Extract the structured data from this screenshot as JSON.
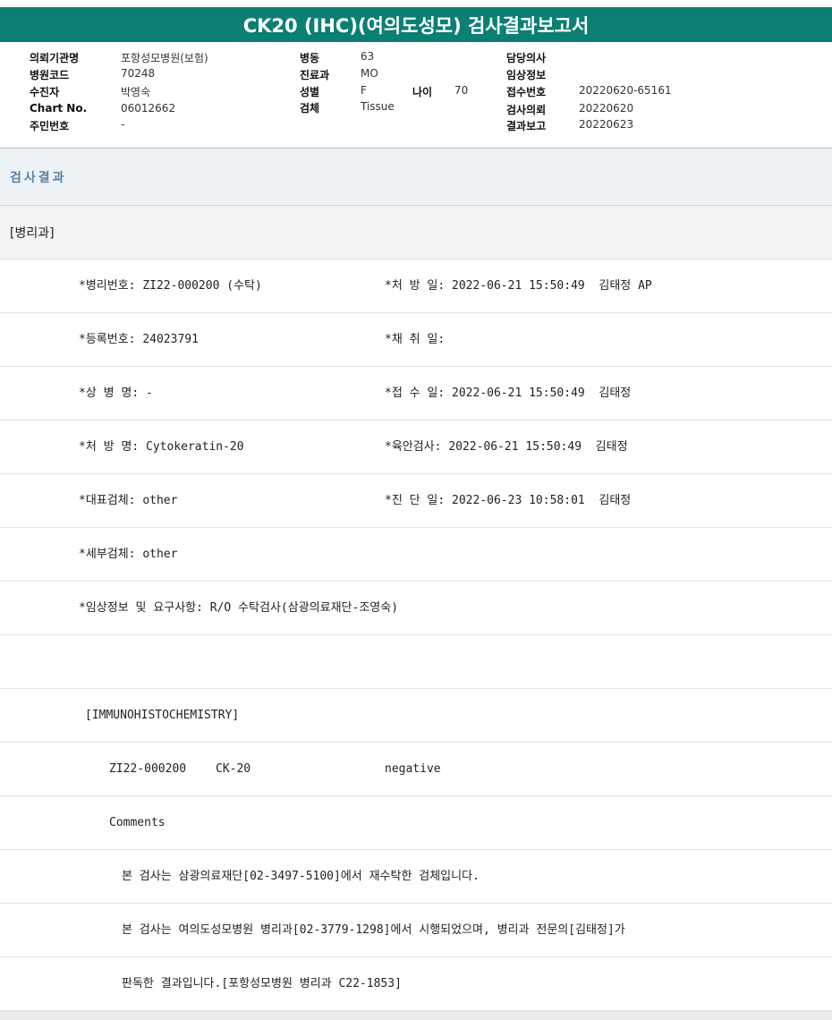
{
  "title": "CK20 (IHC)(여의도성모) 검사결과보고서",
  "header": {
    "institution_label": "의뢰기관명",
    "institution_value": "포항성모병원(보험)",
    "hospital_code_label": "병원코드",
    "hospital_code_value": "70248",
    "examinee_label": "수진자",
    "examinee_value": "박영숙",
    "chart_no_label": "Chart No.",
    "chart_no_value": "06012662",
    "resident_no_label": "주민번호",
    "resident_no_value": "-",
    "ward_label": "병동",
    "ward_value": "63",
    "department_label": "진료과",
    "department_value": "MO",
    "sex_label": "성별",
    "sex_value": "F",
    "age_label": "나이",
    "age_value": "70",
    "specimen_label": "검체",
    "specimen_value": "Tissue",
    "doctor_label": "담당의사",
    "doctor_value": "",
    "clinical_info_label": "임상정보",
    "clinical_info_value": "",
    "receipt_no_label": "접수번호",
    "receipt_no_value": "20220620-65161",
    "request_label": "검사의뢰",
    "request_value": "20220620",
    "report_label": "결과보고",
    "report_value": "20220623"
  },
  "section_title": "검사결과",
  "dept": "[병리과]",
  "rows": [
    {
      "left": "*병리번호: ZI22-000200 (수탁)",
      "right": "*처 방 일: 2022-06-21 15:50:49  김태정 AP"
    },
    {
      "left": "*등록번호: 24023791",
      "right": "*채 취 일:"
    },
    {
      "left": "*상 병 명: -",
      "right": "*접 수 일: 2022-06-21 15:50:49  김태정"
    },
    {
      "left": "*처 방 명: Cytokeratin-20",
      "right": "*육안검사: 2022-06-21 15:50:49  김태정"
    },
    {
      "left": "*대표검체: other",
      "right": "*진 단 일: 2022-06-23 10:58:01  김태정"
    },
    {
      "left": "*세부검체: other"
    },
    {
      "left": "*임상정보 및 요구사항: R/O 수탁검사(삼광의료재단-조영숙)"
    }
  ],
  "ihc_header": "[IMMUNOHISTOCHEMISTRY]",
  "result": {
    "number": "ZI22-000200",
    "marker": "CK-20",
    "value": "negative"
  },
  "comments_label": "Comments",
  "comments": [
    "본 검사는 삼광의료재단[02-3497-5100]에서 재수탁한 검체입니다.",
    "본 검사는 여의도성모병원 병리과[02-3779-1298]에서 시행되었으며, 병리과 전문의[김태정]가",
    "판독한 결과입니다.[포항성모병원 병리과 C22-1853]"
  ],
  "colors": {
    "title_bar": "#0c7f74",
    "section_title_text": "#5a84a9",
    "section_bg": "#edf2f7"
  }
}
